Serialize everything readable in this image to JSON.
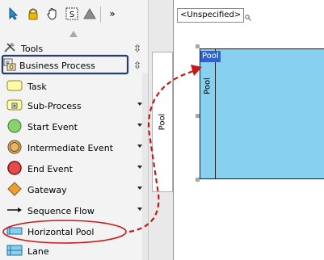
{
  "palette": {
    "toolbar_icons": [
      "pointer-icon",
      "lock-icon",
      "hand-icon",
      "selection-mode-icon",
      "shape-triangle-icon",
      "overflow-chevron-icon"
    ],
    "s_label": "S",
    "overflow_label": "»",
    "categories": [
      {
        "label": "Tools",
        "icon": "tools-icon",
        "expander": "⇳"
      },
      {
        "label": "Business Process",
        "icon": "business-process-icon",
        "expander": "⇳"
      }
    ],
    "items": [
      {
        "label": "Task",
        "icon": "task-icon",
        "has_submenu": false
      },
      {
        "label": "Sub-Process",
        "icon": "subprocess-icon",
        "has_submenu": true
      },
      {
        "label": "Start Event",
        "icon": "start-event-icon",
        "has_submenu": true
      },
      {
        "label": "Intermediate Event",
        "icon": "intermediate-event-icon",
        "has_submenu": true
      },
      {
        "label": "End Event",
        "icon": "end-event-icon",
        "has_submenu": true
      },
      {
        "label": "Gateway",
        "icon": "gateway-icon",
        "has_submenu": true
      },
      {
        "label": "Sequence Flow",
        "icon": "sequence-flow-icon",
        "has_submenu": true
      },
      {
        "label": "Horizontal Pool",
        "icon": "horizontal-pool-icon",
        "has_submenu": false
      },
      {
        "label": "Lane",
        "icon": "lane-icon",
        "has_submenu": false
      }
    ]
  },
  "side_tab": {
    "label": "Pool"
  },
  "canvas": {
    "scope_label": "<Unspecified>",
    "pool_title": "Pool",
    "pool_vertical_label": "Pool"
  },
  "colors": {
    "highlight_box": "#22406a",
    "annotation_red": "#c41a1a",
    "pool_fill": "#87d0f0",
    "pool_title_bg": "#2f63c8"
  }
}
